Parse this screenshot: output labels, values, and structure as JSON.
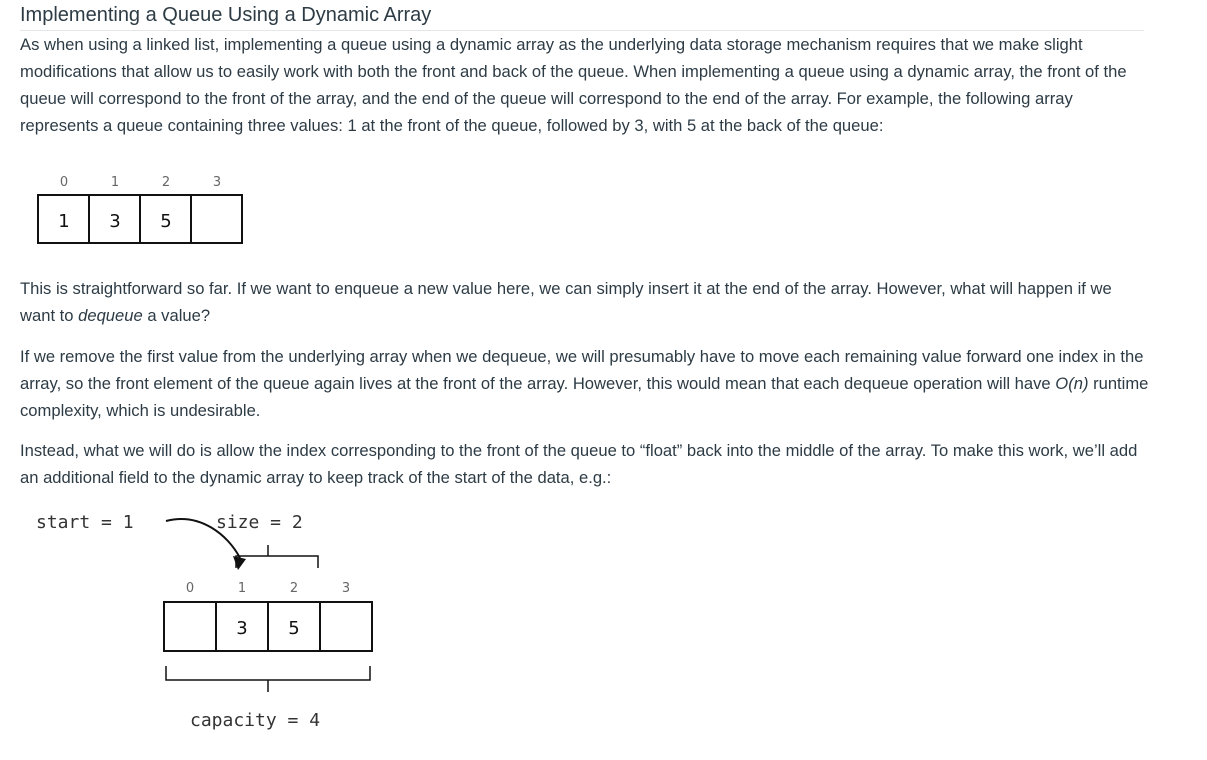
{
  "page_title": "Implementing a Queue Using a Dynamic Array",
  "para1": "As when using a linked list, implementing a queue using a dynamic array as the underlying data storage mechanism requires that we make slight modifications that allow us to easily work with both the front and back of the queue. When implementing a queue using a dynamic array, the front of the queue will correspond to the front of the array, and the end of the queue will correspond to the end of the array. For example, the following array represents a queue containing three values: 1 at the front of the queue, followed by 3, with 5 at the back of the queue:",
  "para2": {
    "before": "This is straightforward so far.  If we want to enqueue a new value here, we can simply insert it at the end of the array.  However, what will happen if we want to ",
    "emph": "dequeue",
    "after": " a value?"
  },
  "para3": {
    "before": "If we remove the first value from the underlying array when we dequeue, we will presumably have to move each remaining value forward one index in the array, so the front element of the queue again lives at the front of the array.  However, this would mean that each dequeue operation will have ",
    "emph": "O(n)",
    "after": " runtime complexity, which is undesirable."
  },
  "para4": "Instead, what we will do is allow the index corresponding to the front of the queue to “float” back into the middle of the array.  To make this work, we’ll add an additional field to the dynamic array to keep track of the start of the data, e.g.:",
  "figure1": {
    "indices": [
      "0",
      "1",
      "2",
      "3"
    ],
    "cells": [
      "1",
      "3",
      "5",
      ""
    ]
  },
  "figure2": {
    "start_label": "start = 1",
    "size_label": "size = 2",
    "capacity_label": "capacity = 4",
    "indices": [
      "0",
      "1",
      "2",
      "3"
    ],
    "cells": [
      "",
      "3",
      "5",
      ""
    ]
  }
}
